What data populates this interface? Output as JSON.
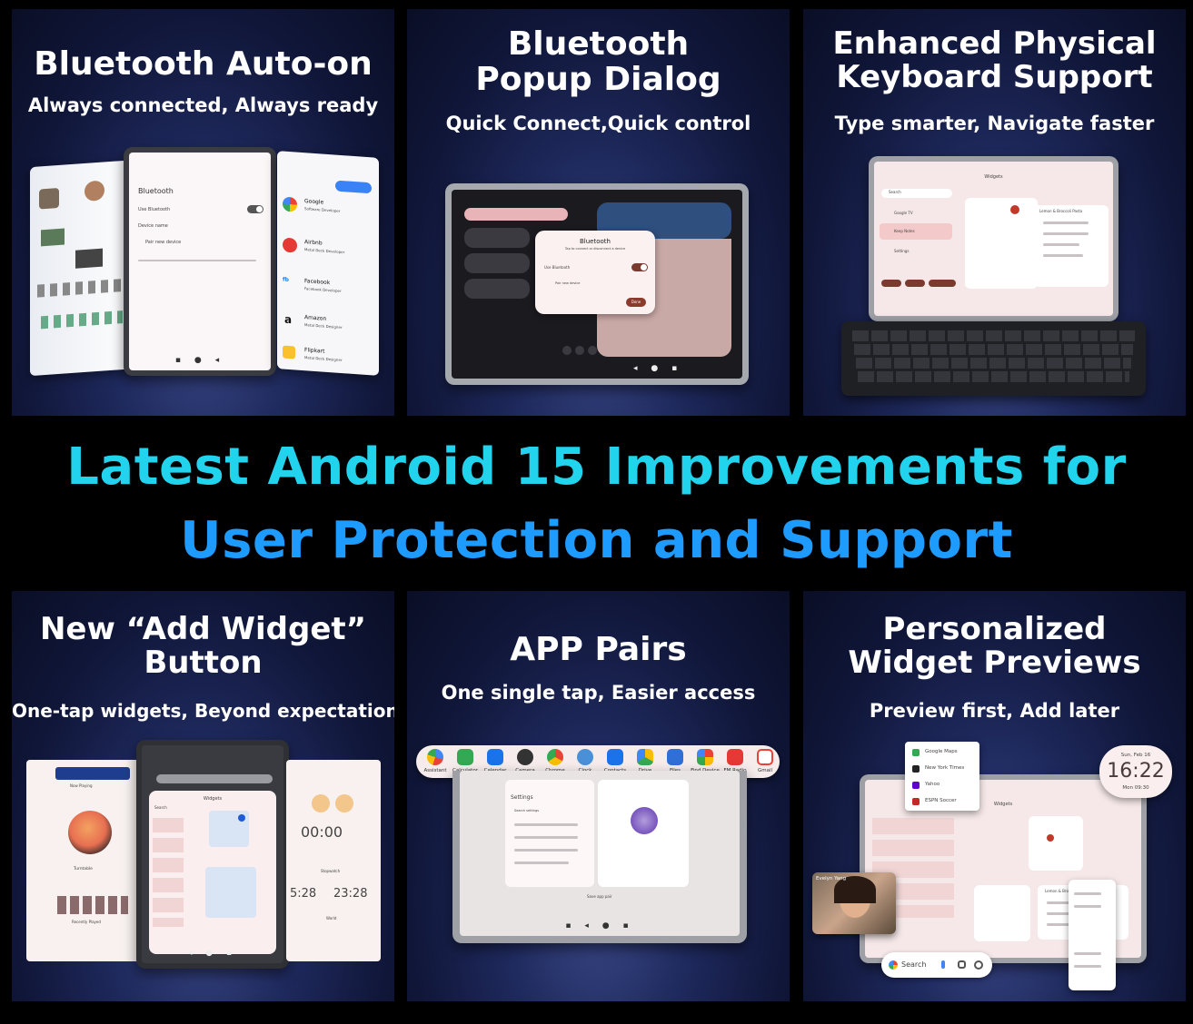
{
  "panels": {
    "p1": {
      "title": "Bluetooth Auto-on",
      "subtitle": "Always connected, Always ready",
      "screen": {
        "heading": "Bluetooth",
        "use_bt": "Use Bluetooth",
        "device_name": "Device name",
        "pair": "Pair new device"
      },
      "apps": [
        {
          "name": "Google",
          "sub": "Software Developer"
        },
        {
          "name": "Airbnb",
          "sub": "Metal Deck Developer"
        },
        {
          "name": "Facebook",
          "sub": "Facebook Developer"
        },
        {
          "name": "Amazon",
          "sub": "Metal Deck Designer"
        },
        {
          "name": "Flipkart",
          "sub": "Metal Deck Designer"
        }
      ]
    },
    "p2": {
      "title": "Bluetooth\nPopup Dialog",
      "subtitle": "Quick Connect,Quick control",
      "dialog": {
        "title": "Bluetooth",
        "sub": "Tap to connect or disconnect a device",
        "use_bt": "Use Bluetooth",
        "pair": "Pair new device",
        "done": "Done"
      }
    },
    "p3": {
      "title": "Enhanced Physical\nKeyboard Support",
      "subtitle": "Type smarter, Navigate faster",
      "screen": {
        "widgets": "Widgets",
        "search": "Search",
        "items": [
          "Google TV",
          "Keep Notes",
          "Settings"
        ],
        "list_title": "Lemon & Broccoli Pasta"
      }
    },
    "p4": {
      "title": "New “Add Widget”\nButton",
      "subtitle": "One-tap widgets, Beyond expectations",
      "screen": {
        "widgets": "Widgets",
        "search": "Search",
        "timer": "00:00",
        "clock_a": "5:28",
        "clock_b": "23:28",
        "now_playing": "Now Playing",
        "turntable": "Turntable",
        "recently": "Recently Played",
        "stopwatch": "Stopwatch",
        "world": "World"
      }
    },
    "p5": {
      "title": "APP Pairs",
      "subtitle": "One single tap, Easier access",
      "dock": [
        "Assistant",
        "Calculator",
        "Calendar",
        "Camera",
        "Chrome",
        "Clock",
        "Contacts",
        "Drive",
        "Files",
        "Find Device",
        "FM Radio",
        "Gmail"
      ],
      "screen": {
        "settings": "Settings",
        "search": "Search settings",
        "save": "Save app pair"
      }
    },
    "p6": {
      "title": "Personalized\nWidget Previews",
      "subtitle": "Preview first, Add later",
      "clock": {
        "date": "Sun, Feb 16",
        "time": "16:22",
        "alarm": "Mon 09:30"
      },
      "menu": [
        "Google Maps",
        "New York Times",
        "Yahoo",
        "ESPN Soccer"
      ],
      "caller": "Evelyn Yang",
      "search": "Search",
      "widgets": "Widgets",
      "list_title": "Lemon & Broccoli Pasta"
    }
  },
  "headline": {
    "line1": "Latest Android 15 Improvements for",
    "line2": "User Protection and Support"
  },
  "colors": {
    "line1": "#22d3ee",
    "line2": "#1e9bff",
    "panel": "#141b45"
  }
}
